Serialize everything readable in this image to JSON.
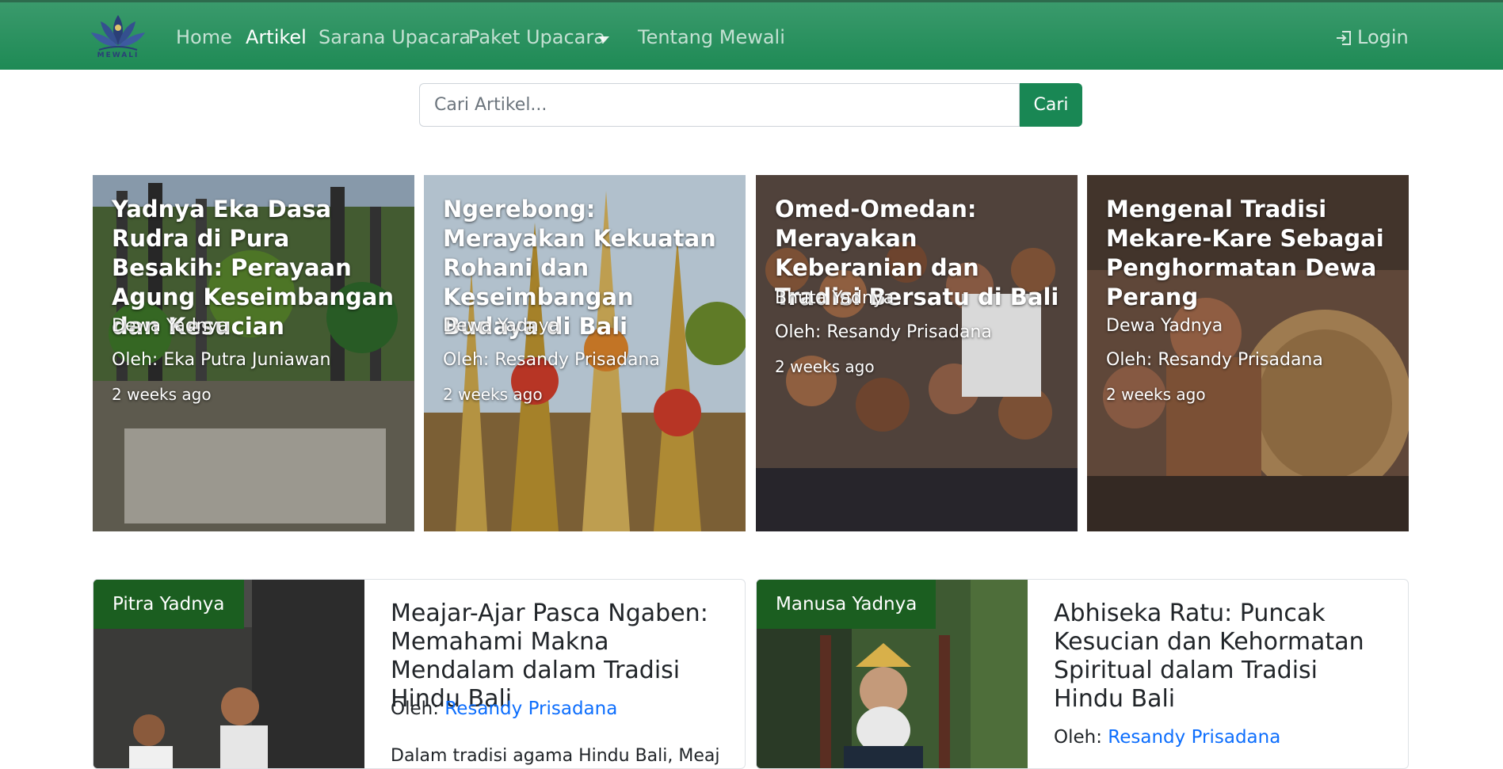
{
  "brand": {
    "logo_text": "MEWALI"
  },
  "nav": {
    "home": "Home",
    "artikel": "Artikel",
    "sarana": "Sarana Upacara",
    "paket": "Paket Upacara",
    "tentang": "Tentang Mewali",
    "login": "Login"
  },
  "search": {
    "placeholder": "Cari Artikel...",
    "button": "Cari"
  },
  "featured": [
    {
      "title": "Yadnya Eka Dasa Rudra di Pura Besakih: Perayaan Agung Keseimbangan dan Kesucian",
      "category": "Dewa Yadnya",
      "author": "Oleh: Eka Putra Juniawan",
      "time": "2 weeks ago"
    },
    {
      "title": "Ngerebong: Merayakan Kekuatan Rohani dan Keseimbangan Budaya di Bali",
      "category": "Dewa Yadnya",
      "author": "Oleh: Resandy Prisadana",
      "time": "2 weeks ago"
    },
    {
      "title": "Omed-Omedan: Merayakan Keberanian dan Tradisi Bersatu di Bali",
      "category": "Bhuta Yadnya",
      "author": "Oleh: Resandy Prisadana",
      "time": "2 weeks ago"
    },
    {
      "title": "Mengenal Tradisi Mekare-Kare Sebagai Penghormatan Dewa Perang",
      "category": "Dewa Yadnya",
      "author": "Oleh: Resandy Prisadana",
      "time": "2 weeks ago"
    }
  ],
  "articles": [
    {
      "badge": "Pitra Yadnya",
      "title": "Meajar-Ajar Pasca Ngaben: Memahami Makna Mendalam dalam Tradisi Hindu Bali",
      "author_prefix": "Oleh:",
      "author": "Resandy Prisadana",
      "excerpt": "Dalam tradisi agama Hindu Bali, Meaj"
    },
    {
      "badge": "Manusa Yadnya",
      "title": "Abhiseka Ratu: Puncak Kesucian dan Kehormatan Spiritual dalam Tradisi Hindu Bali",
      "author_prefix": "Oleh:",
      "author": "Resandy Prisadana"
    }
  ]
}
